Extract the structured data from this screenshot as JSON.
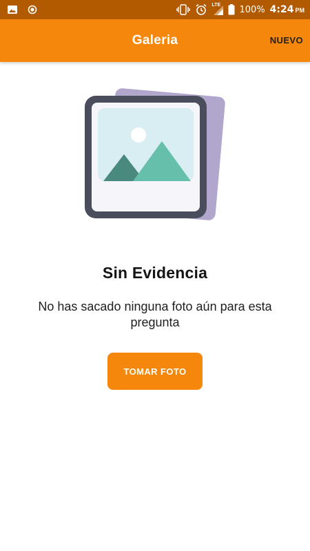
{
  "status_bar": {
    "battery_percent": "100%",
    "time": "4:24",
    "time_suffix": "PM",
    "network": "LTE",
    "icons": [
      "image-icon",
      "record-icon",
      "vibrate-icon",
      "alarm-icon",
      "signal-icon",
      "battery-icon"
    ]
  },
  "app_bar": {
    "title": "Galeria",
    "action_label": "NUEVO"
  },
  "empty_state": {
    "illustration": "photo-stack-icon",
    "title": "Sin Evidencia",
    "message": "No has sacado ninguna foto aún para esta pregunta",
    "button_label": "TOMAR FOTO"
  },
  "colors": {
    "status_bar": "#b25a00",
    "accent": "#f5880c",
    "frame": "#4a4e5c",
    "back_photo": "#b1a7cc",
    "sky": "#d9eef2",
    "mountain_dark": "#4a8a7e",
    "mountain_light": "#66bfaa"
  }
}
